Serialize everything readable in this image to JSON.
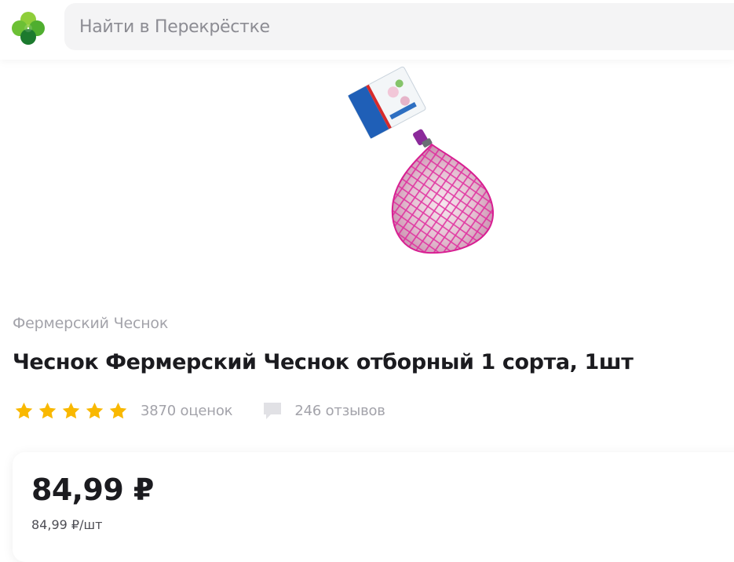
{
  "header": {
    "logo_icon": "clover-logo-icon",
    "search": {
      "placeholder": "Найти в Перекрёстке",
      "value": ""
    }
  },
  "product": {
    "image": "garlic-in-pink-net-bag",
    "brand": "Фермерский Чеснок",
    "title": "Чеснок Фермерский Чеснок отборный 1 сорта, 1шт",
    "rating": {
      "stars": 5,
      "max_stars": 5,
      "count_label": "3870 оценок",
      "star_color": "#f9b800"
    },
    "reviews": {
      "icon": "comment-icon",
      "label": "246 отзывов"
    },
    "price": {
      "value": "84,99 ₽",
      "unit_price": "84,99 ₽/шт"
    }
  },
  "colors": {
    "brand_green": "#5faf2c",
    "dark_green": "#1c7a2e",
    "text_primary": "#1b1b1f",
    "text_secondary": "#a3a3aa",
    "search_bg": "#f4f4f5"
  }
}
